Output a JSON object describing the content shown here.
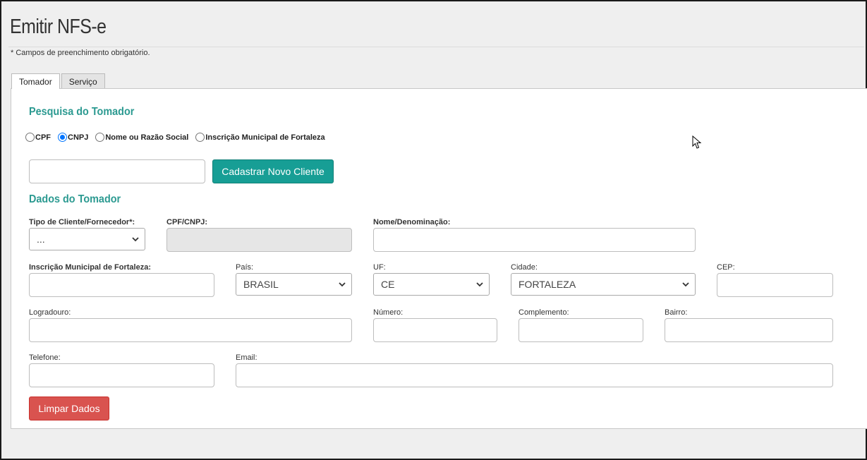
{
  "page": {
    "title": "Emitir NFS-e",
    "required_note": "* Campos de preenchimento obrigatório."
  },
  "tabs": [
    {
      "label": "Tomador",
      "active": true
    },
    {
      "label": "Serviço",
      "active": false
    }
  ],
  "search": {
    "section_title": "Pesquisa do Tomador",
    "radio_options": [
      "CPF",
      "CNPJ",
      "Nome ou Razão Social",
      "Inscrição Municipal de Fortaleza"
    ],
    "selected": "CNPJ",
    "input_value": "",
    "new_client_button": "Cadastrar Novo Cliente"
  },
  "dados": {
    "section_title": "Dados do Tomador",
    "tipo_label": "Tipo de Cliente/Fornecedor*:",
    "tipo_value": "...",
    "cpf_cnpj_label": "CPF/CNPJ:",
    "nome_label": "Nome/Denominação:",
    "inscricao_label": "Inscrição Municipal de Fortaleza:",
    "pais_label": "País:",
    "pais_value": "BRASIL",
    "uf_label": "UF:",
    "uf_value": "CE",
    "cidade_label": "Cidade:",
    "cidade_value": "FORTALEZA",
    "cep_label": "CEP:",
    "logradouro_label": "Logradouro:",
    "numero_label": "Número:",
    "complemento_label": "Complemento:",
    "bairro_label": "Bairro:",
    "telefone_label": "Telefone:",
    "email_label": "Email:",
    "clear_button": "Limpar Dados"
  },
  "colors": {
    "accent": "#179e95",
    "danger": "#d9534f",
    "section_title": "#2c9a91",
    "radio_checked": "#0075ff"
  }
}
